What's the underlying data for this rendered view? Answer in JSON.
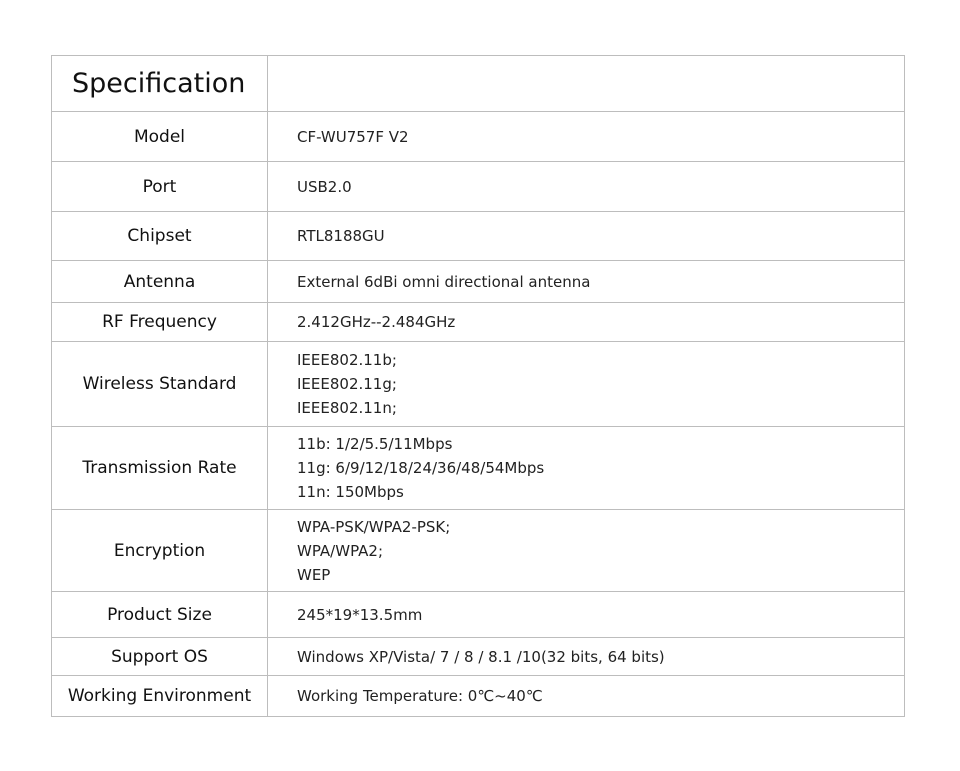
{
  "title": "Specification",
  "rows": [
    {
      "label": "Model",
      "lines": [
        "CF-WU757F V2"
      ]
    },
    {
      "label": "Port",
      "lines": [
        "USB2.0"
      ]
    },
    {
      "label": "Chipset",
      "lines": [
        "RTL8188GU"
      ]
    },
    {
      "label": "Antenna",
      "lines": [
        "External 6dBi omni directional antenna"
      ]
    },
    {
      "label": "RF Frequency",
      "lines": [
        "2.412GHz--2.484GHz"
      ]
    },
    {
      "label": "Wireless Standard",
      "lines": [
        "IEEE802.11b;",
        "IEEE802.11g;",
        "IEEE802.11n;"
      ]
    },
    {
      "label": "Transmission Rate",
      "lines": [
        "11b: 1/2/5.5/11Mbps",
        "11g: 6/9/12/18/24/36/48/54Mbps",
        "11n: 150Mbps"
      ]
    },
    {
      "label": "Encryption",
      "lines": [
        "WPA-PSK/WPA2-PSK;",
        "WPA/WPA2;",
        "WEP"
      ]
    },
    {
      "label": "Product Size",
      "lines": [
        "245*19*13.5mm"
      ]
    },
    {
      "label": "Support OS",
      "lines": [
        "Windows XP/Vista/ 7 / 8 / 8.1 /10(32 bits, 64 bits)"
      ]
    },
    {
      "label": "Working Environment",
      "lines": [
        "Working Temperature: 0℃~40℃"
      ]
    }
  ]
}
